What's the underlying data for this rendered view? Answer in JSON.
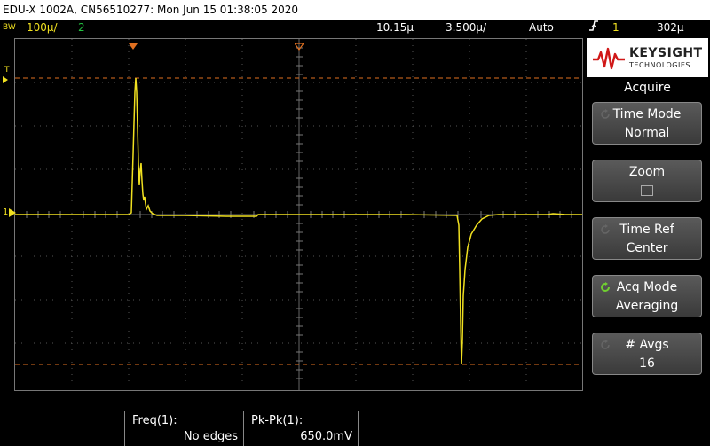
{
  "window": {
    "title": "EDU-X 1002A, CN56510277: Mon Jun 15 01:38:05 2020"
  },
  "status": {
    "bw_label": "BW",
    "ch1_scale": "100ℤ/",
    "ch2_label": "2",
    "time_scale": "10.15ℤ",
    "time_pos": "3.500ℤ/",
    "trigger_mode": "Auto",
    "trigger_icon": "rising-edge-icon",
    "trigger_source": "1",
    "trigger_level": "302ℤ"
  },
  "status_display": {
    "ch1_scale": "100µ/",
    "time_scale": "10.15µ",
    "time_pos": "3.500µ/",
    "trigger_level": "302µ"
  },
  "colors": {
    "ch1": "#f0e020",
    "ch2": "#22c040",
    "cursor": "#e07020",
    "grid": "#777777",
    "softkey_active": "#70d030"
  },
  "graticule": {
    "trigger_marker": "T",
    "ground_marker": "1"
  },
  "brand": {
    "name": "KEYSIGHT",
    "sub": "TECHNOLOGIES"
  },
  "menu": {
    "title": "Acquire",
    "softkeys": [
      {
        "line1": "Time Mode",
        "line2": "Normal"
      },
      {
        "line1": "Zoom",
        "line2": ""
      },
      {
        "line1": "Time Ref",
        "line2": "Center"
      },
      {
        "line1": "Acq Mode",
        "line2": "Averaging"
      },
      {
        "line1": "# Avgs",
        "line2": "16"
      }
    ]
  },
  "measurements": [
    {
      "label": "Freq(1):",
      "value": "No edges"
    },
    {
      "label": "Pk-Pk(1):",
      "value": "650.0mV"
    }
  ]
}
